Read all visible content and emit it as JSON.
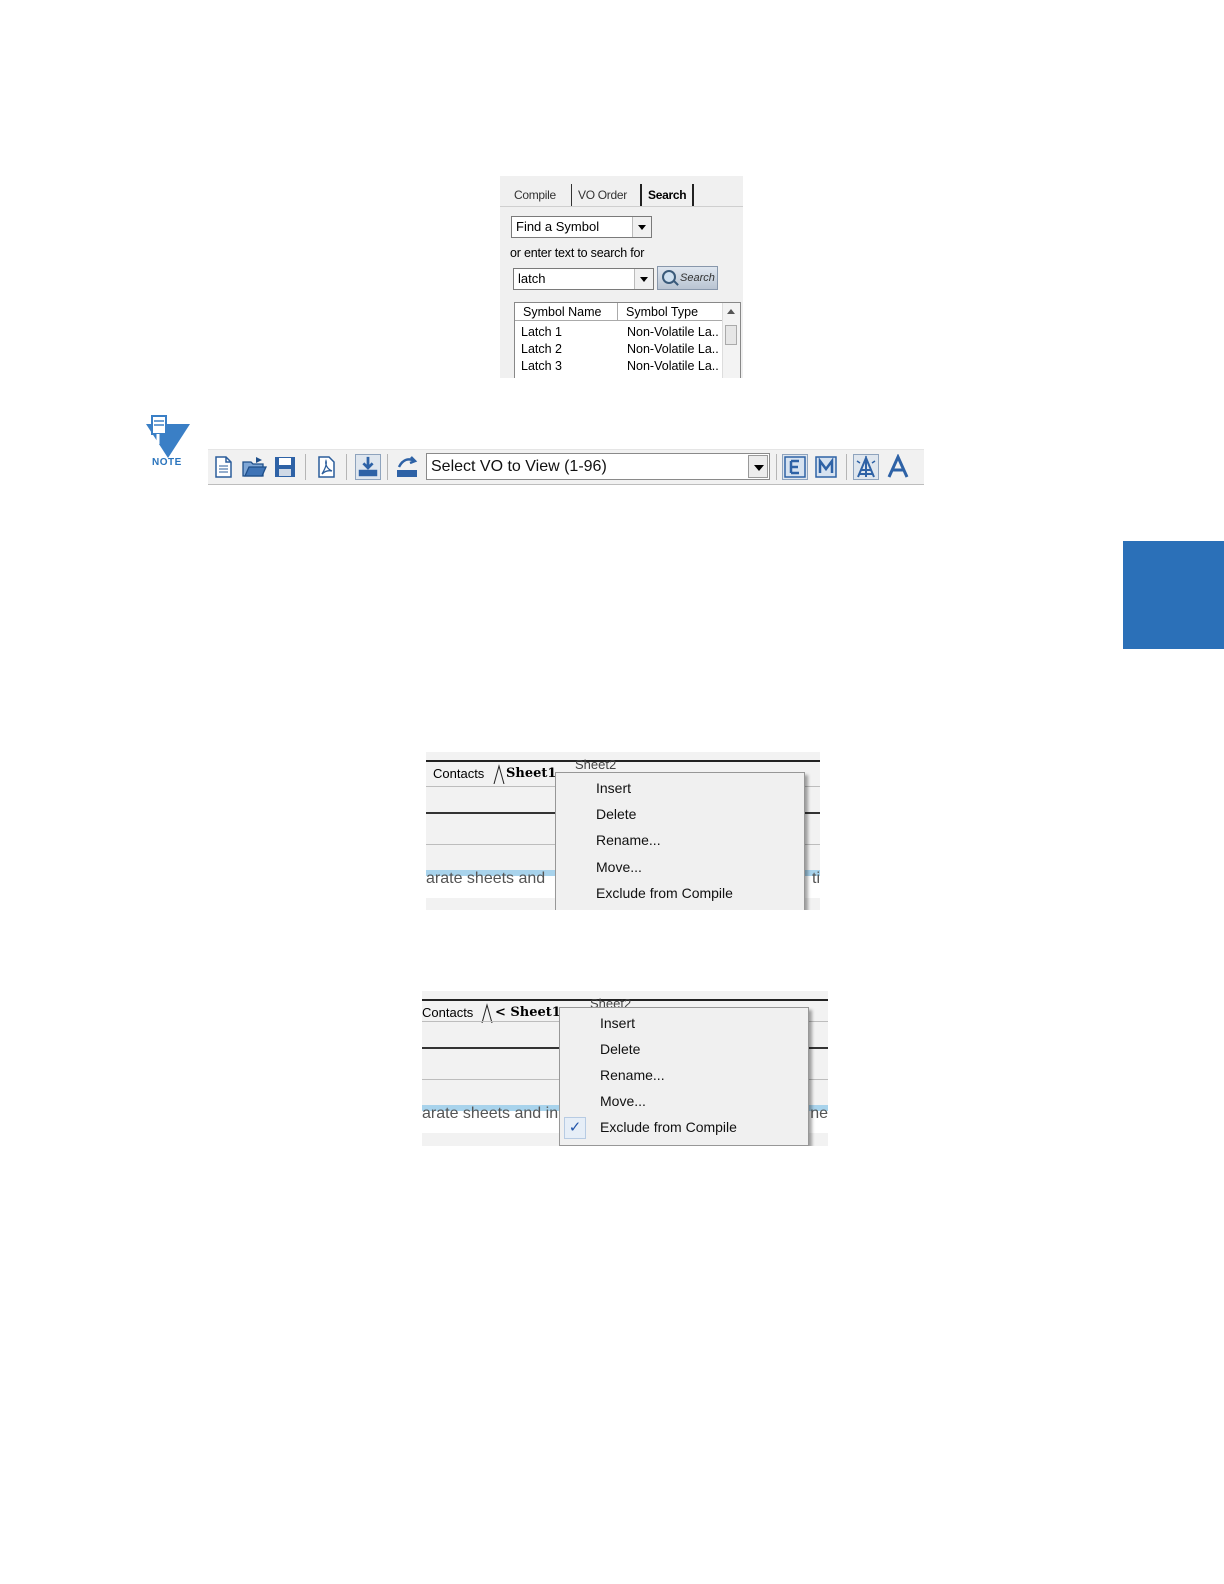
{
  "search_panel": {
    "tabs": [
      {
        "label": "Compile"
      },
      {
        "label": "VO Order"
      },
      {
        "label": "Search",
        "active": true
      }
    ],
    "search_type": {
      "selected": "Find a Symbol"
    },
    "enter_text_label": "or enter text to search for",
    "search_input": {
      "value": "latch"
    },
    "search_button": "Search",
    "results": {
      "columns": [
        "Symbol Name",
        "Symbol Type"
      ],
      "rows": [
        [
          "Latch 1",
          "Non-Volatile La.."
        ],
        [
          "Latch 2",
          "Non-Volatile La.."
        ],
        [
          "Latch 3",
          "Non-Volatile La.."
        ]
      ]
    }
  },
  "note": {
    "label": "NOTE",
    "icon": "note-icon",
    "color": "#2a74bd"
  },
  "toolbar": {
    "buttons": [
      "new-file-icon",
      "open-folder-icon",
      "save-icon",
      "pdf-icon",
      "download-icon",
      "upload-icon",
      "e-icon",
      "m-icon",
      "compile-tower-icon",
      "a-icon"
    ],
    "vo_select": {
      "selected": "Select VO to View (1-96)"
    }
  },
  "side_tab": {
    "color": "#2b70b8"
  },
  "sheet_menu_1": {
    "tabs": [
      "Contacts",
      "Sheet1",
      "Sheet2"
    ],
    "background_text_left": "arate sheets and",
    "background_text_right": "ti",
    "menu_items": [
      "Insert",
      "Delete",
      "Rename...",
      "Move...",
      "Exclude from Compile"
    ],
    "exclude_checked": false
  },
  "sheet_menu_2": {
    "tabs": [
      "Contacts",
      "< Sheet1 >",
      "Sheet2"
    ],
    "background_text_left": "arate sheets and in",
    "background_text_right": "ne",
    "menu_items": [
      "Insert",
      "Delete",
      "Rename...",
      "Move...",
      "Exclude from Compile"
    ],
    "exclude_checked": true,
    "check_mark": "✓"
  }
}
